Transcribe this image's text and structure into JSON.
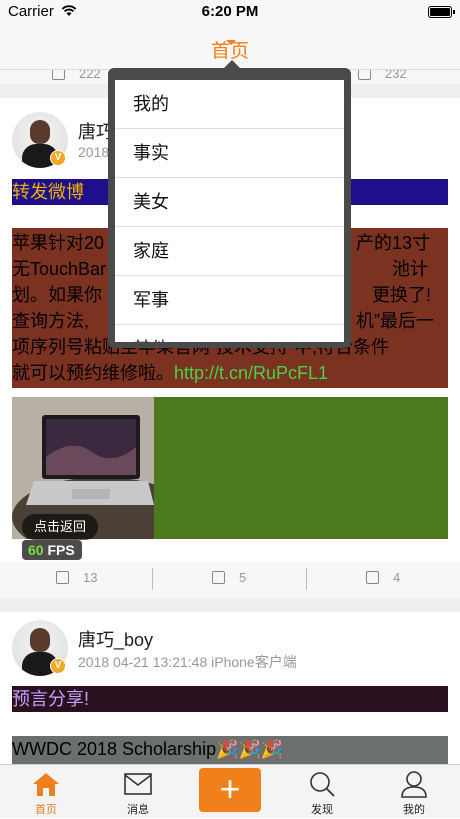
{
  "status_bar": {
    "carrier": "Carrier",
    "time": "6:20 PM"
  },
  "nav": {
    "title": "首页"
  },
  "top_counts": {
    "left": "222",
    "right": "232"
  },
  "post1": {
    "name": "唐巧",
    "date": "2018",
    "repost_label": "转发微博",
    "text_lines": [
      "苹果针对20",
      "产的13寸",
      "无TouchBar",
      "池计",
      "划。如果你",
      "更换了!",
      "查询方法,",
      "机”最后一",
      "项序列号粘贴至苹果官网“技术支持”中,符合条件",
      "就可以预约维修啦。"
    ],
    "link": "http://t.cn/RuPcFL1",
    "back_button": "点击返回",
    "fps_value": "60",
    "fps_label": "FPS",
    "actions": [
      "13",
      "5",
      "4"
    ]
  },
  "post2": {
    "name": "唐巧_boy",
    "meta": "2018 04-21 13:21:48  iPhone客户端",
    "repost_label": "预言分享!",
    "content_line": "WWDC 2018 Scholarship🎉🎉🎉"
  },
  "popup_menu": {
    "items": [
      "我的",
      "事实",
      "美女",
      "家庭",
      "军事",
      "其他"
    ]
  },
  "tab_bar": {
    "items": [
      {
        "label": "首页",
        "active": true
      },
      {
        "label": "消息",
        "active": false
      },
      {
        "label": "",
        "active": false
      },
      {
        "label": "发现",
        "active": false
      },
      {
        "label": "我的",
        "active": false
      }
    ]
  },
  "colors": {
    "accent": "#f0801c",
    "link": "#4ad14a",
    "repost_bg": "#1f0f8b",
    "content_bg": "#7c3220",
    "image_bg": "#4d7a1e"
  }
}
